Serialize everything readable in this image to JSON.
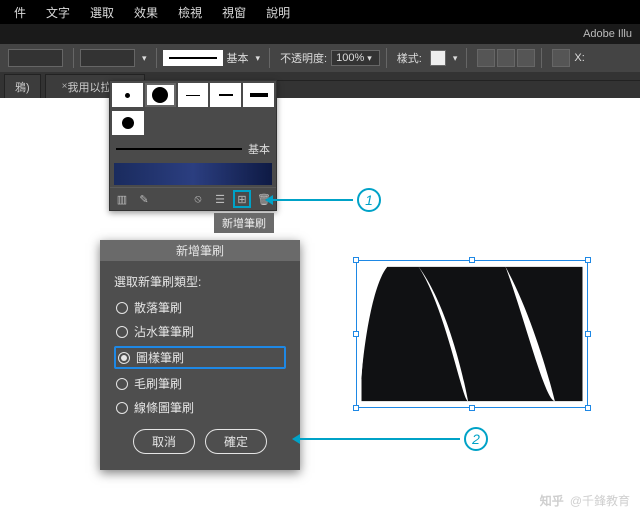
{
  "menu": {
    "items": [
      "件",
      "文字",
      "選取",
      "效果",
      "檢視",
      "視窗",
      "說明"
    ]
  },
  "app": {
    "title": "Adobe Illu"
  },
  "ctrl": {
    "brush_style_label": "基本",
    "opacity_label": "不透明度:",
    "opacity_value": "100%",
    "style_label": "樣式:",
    "x_label": "X:"
  },
  "tab": {
    "partial": "鴉)",
    "title": "我用以拉拉的"
  },
  "brushes": {
    "basic_label": "基本",
    "new_brush_tooltip": "新增筆刷"
  },
  "dialog": {
    "title": "新增筆刷",
    "prompt": "選取新筆刷類型:",
    "options": [
      "散落筆刷",
      "沾水筆筆刷",
      "圖樣筆刷",
      "毛刷筆刷",
      "線條圖筆刷"
    ],
    "selected_index": 2,
    "cancel": "取消",
    "ok": "確定"
  },
  "steps": {
    "one": "1",
    "two": "2"
  },
  "watermark": {
    "brand": "知乎",
    "author": "@千鋒教育"
  }
}
